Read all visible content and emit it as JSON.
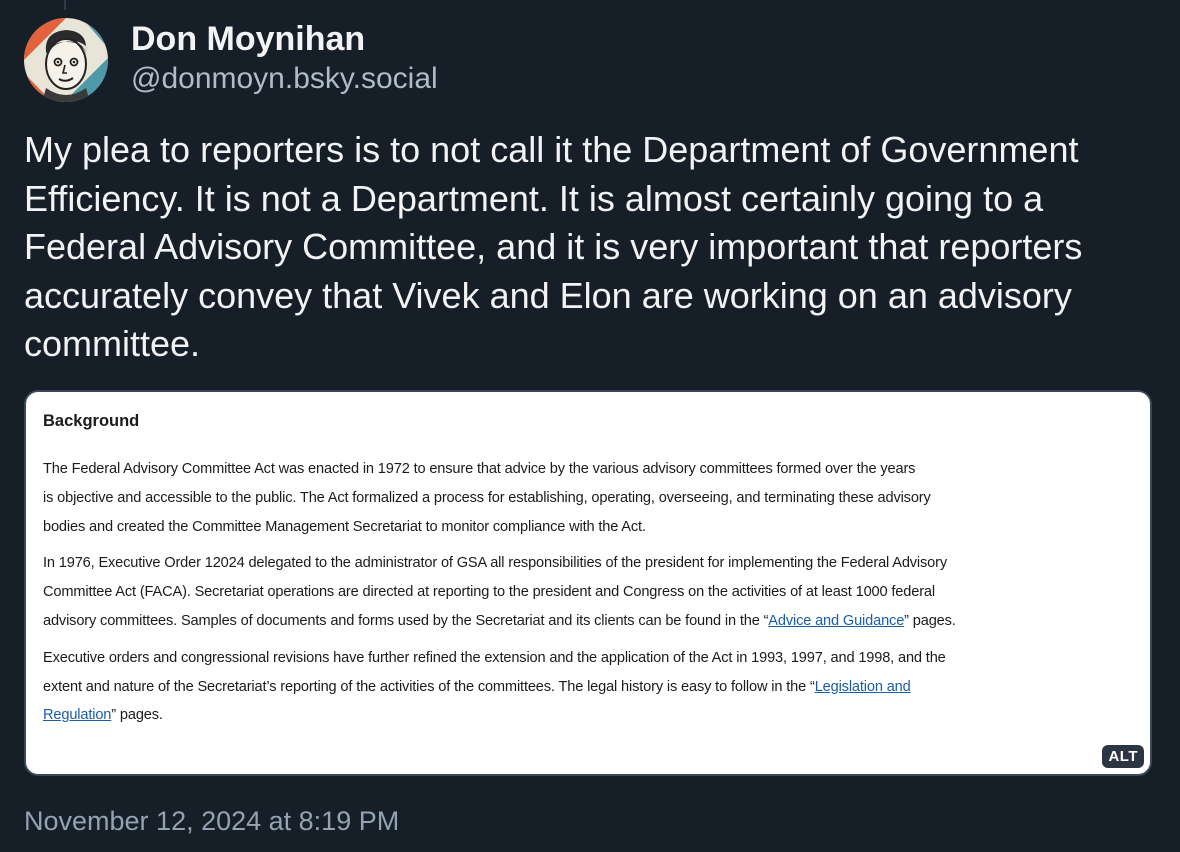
{
  "author": {
    "name": "Don Moynihan",
    "handle": "@donmoyn.bsky.social",
    "avatar_icon": "cartoon-avatar-icon"
  },
  "post": {
    "text": "My plea to reporters is to not call it the Department of Government Efficiency. It is not a Department. It is almost certainly going to a Federal Advisory Committee, and it is very important that reporters accurately convey that Vivek and Elon are working on an advisory committee.",
    "timestamp": "November 12, 2024 at 8:19 PM"
  },
  "embed": {
    "alt_badge": "ALT",
    "heading": "Background",
    "para1": {
      "line1": "The Federal Advisory Committee Act was enacted in 1972 to ensure that advice by the various advisory committees formed over the years",
      "line2": "is objective and accessible to the public. The Act formalized a process for establishing, operating, overseeing, and terminating these advisory",
      "line3": "bodies and created the Committee Management Secretariat to monitor compliance with the Act."
    },
    "para2": {
      "line1": "In 1976, Executive Order 12024 delegated to the administrator of GSA all responsibilities of the president for implementing the Federal Advisory",
      "line2": "Committee Act (FACA). Secretariat operations are directed at reporting to the president and Congress on the activities of at least 1000 federal",
      "line3_before": "advisory committees. Samples of documents and forms used by the Secretariat and its clients can be found in the “",
      "line3_link": "Advice and Guidance",
      "line3_after": "” pages."
    },
    "para3": {
      "line1": "Executive orders and congressional revisions have further refined the extension and the application of the Act in 1993, 1997, and 1998, and the",
      "line2_before": "extent and nature of the Secretariat’s reporting of the activities of the committees. The legal history is easy to follow in the “",
      "line2_link": "Legislation and",
      "line3_link": "Regulation",
      "line3_after": "” pages."
    }
  },
  "colors": {
    "background": "#161e27",
    "text_primary": "#f1f3f5",
    "text_secondary": "#aebbc9",
    "timestamp": "#93a3b4",
    "link": "#1a5ea7"
  }
}
